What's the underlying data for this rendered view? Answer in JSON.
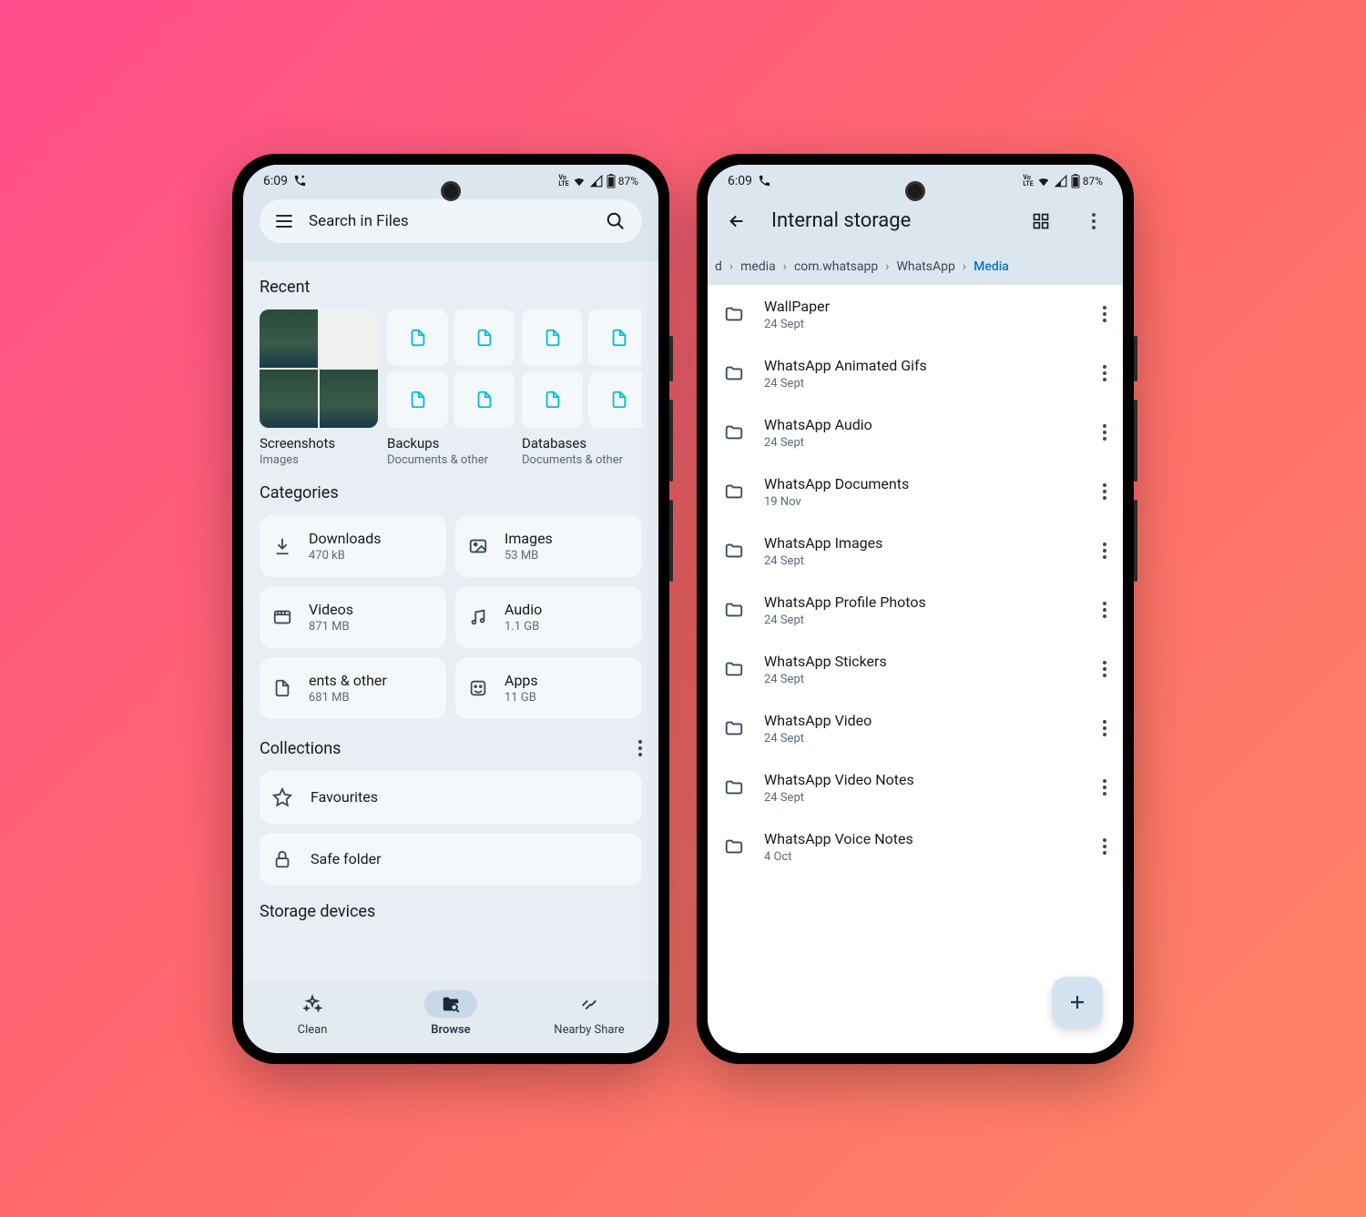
{
  "status": {
    "time": "6:09",
    "battery": "87%",
    "lte": "Vo\nLTE"
  },
  "phone1": {
    "search_placeholder": "Search in Files",
    "recent_heading": "Recent",
    "recent": [
      {
        "title": "Screenshots",
        "subtitle": "Images"
      },
      {
        "title": "Backups",
        "subtitle": "Documents & other"
      },
      {
        "title": "Databases",
        "subtitle": "Documents & other"
      }
    ],
    "categories_heading": "Categories",
    "categories": [
      {
        "name": "Downloads",
        "size": "470 kB"
      },
      {
        "name": "Images",
        "size": "53 MB"
      },
      {
        "name": "Videos",
        "size": "871 MB"
      },
      {
        "name": "Audio",
        "size": "1.1 GB"
      },
      {
        "name": "ents & other",
        "size": "681 MB"
      },
      {
        "name": "Apps",
        "size": "11 GB"
      }
    ],
    "collections_heading": "Collections",
    "collections": [
      {
        "name": "Favourites"
      },
      {
        "name": "Safe folder"
      }
    ],
    "storage_heading": "Storage devices",
    "nav": {
      "clean": "Clean",
      "browse": "Browse",
      "share": "Nearby Share"
    }
  },
  "phone2": {
    "title": "Internal storage",
    "breadcrumb": [
      "d",
      "media",
      "com.whatsapp",
      "WhatsApp",
      "Media"
    ],
    "folders": [
      {
        "name": "WallPaper",
        "date": "24 Sept"
      },
      {
        "name": "WhatsApp Animated Gifs",
        "date": "24 Sept"
      },
      {
        "name": "WhatsApp Audio",
        "date": "24 Sept"
      },
      {
        "name": "WhatsApp Documents",
        "date": "19 Nov"
      },
      {
        "name": "WhatsApp Images",
        "date": "24 Sept"
      },
      {
        "name": "WhatsApp Profile Photos",
        "date": "24 Sept"
      },
      {
        "name": "WhatsApp Stickers",
        "date": "24 Sept"
      },
      {
        "name": "WhatsApp Video",
        "date": "24 Sept"
      },
      {
        "name": "WhatsApp Video Notes",
        "date": "24 Sept"
      },
      {
        "name": "WhatsApp Voice Notes",
        "date": "4 Oct"
      }
    ]
  }
}
